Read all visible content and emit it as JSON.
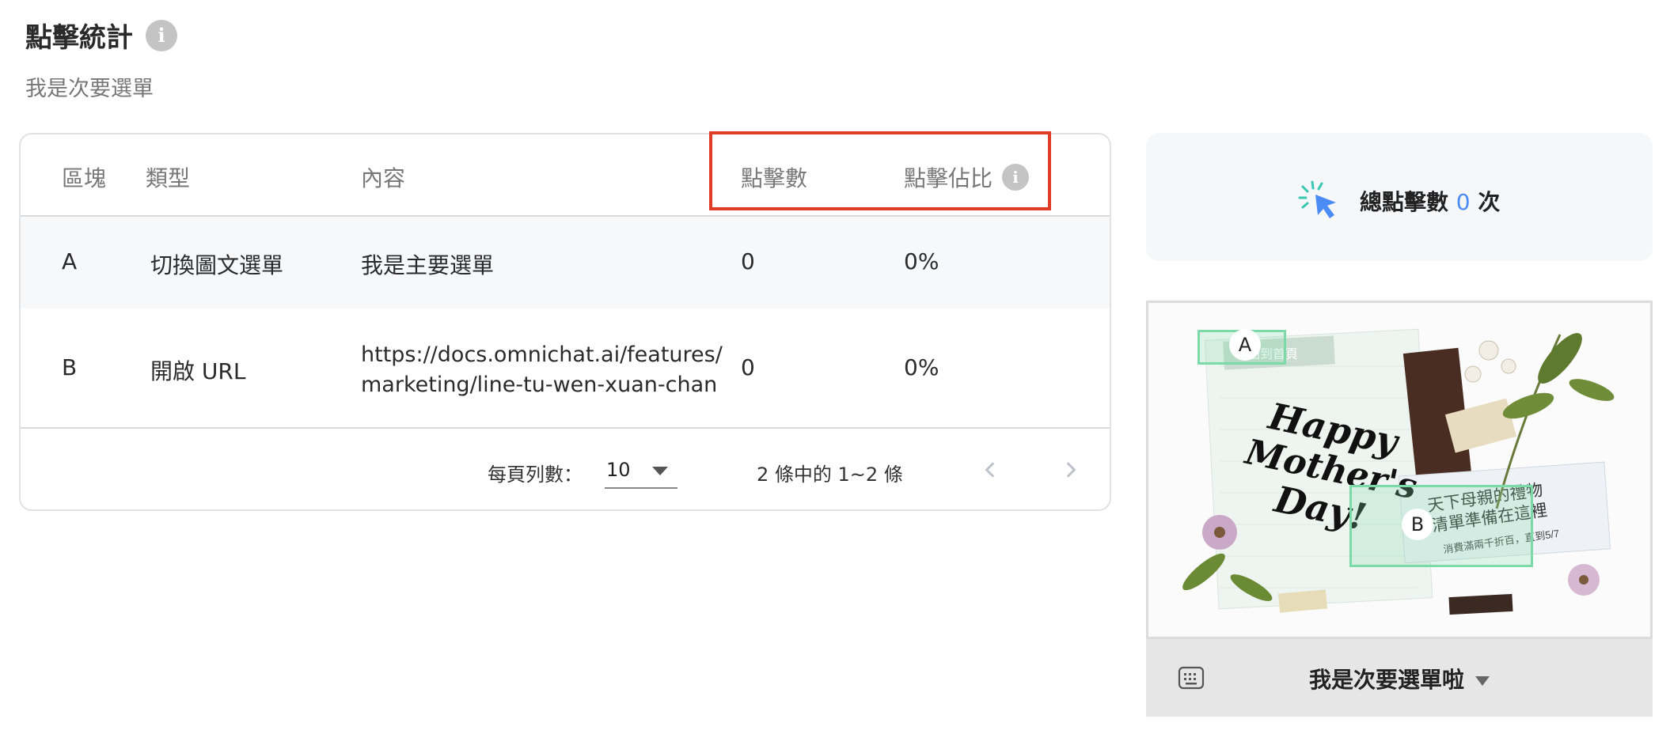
{
  "header": {
    "title": "點擊統計",
    "subtitle": "我是次要選單"
  },
  "table": {
    "columns": {
      "block": "區塊",
      "type": "類型",
      "content": "內容",
      "clicks": "點擊數",
      "share": "點擊佔比"
    },
    "rows": [
      {
        "block": "A",
        "type": "切換圖文選單",
        "content": "我是主要選單",
        "clicks": "0",
        "share": "0%"
      },
      {
        "block": "B",
        "type": "開啟 URL",
        "content_line1": "https://docs.omnichat.ai/features/",
        "content_line2": "marketing/line-tu-wen-xuan-chan",
        "clicks": "0",
        "share": "0%"
      }
    ]
  },
  "pagination": {
    "rows_per_page_label": "每頁列數：",
    "rows_per_page": "10",
    "range": "2 條中的 1~2 條"
  },
  "summary": {
    "label": "總點擊數",
    "count": "0",
    "unit": "次"
  },
  "preview": {
    "menu_bar_label": "我是次要選單啦",
    "areas": [
      "A",
      "B"
    ],
    "image_text": {
      "button": "回到首頁",
      "headline_line1": "Happy",
      "headline_line2": "Mother's",
      "headline_line3": "Day!",
      "cn_line1": "天下母親的禮物",
      "cn_line2": "清單準備在這裡",
      "cn_line3": "消費滿兩千折百，直到5/7"
    }
  },
  "colors": {
    "accent": "#4b8bf5",
    "highlight": "#e03c26",
    "area": "#7cd9a8"
  },
  "icons": [
    "info-icon",
    "cursor-click-icon",
    "keyboard-icon",
    "chevron-left-icon",
    "chevron-right-icon",
    "caret-down-icon"
  ]
}
